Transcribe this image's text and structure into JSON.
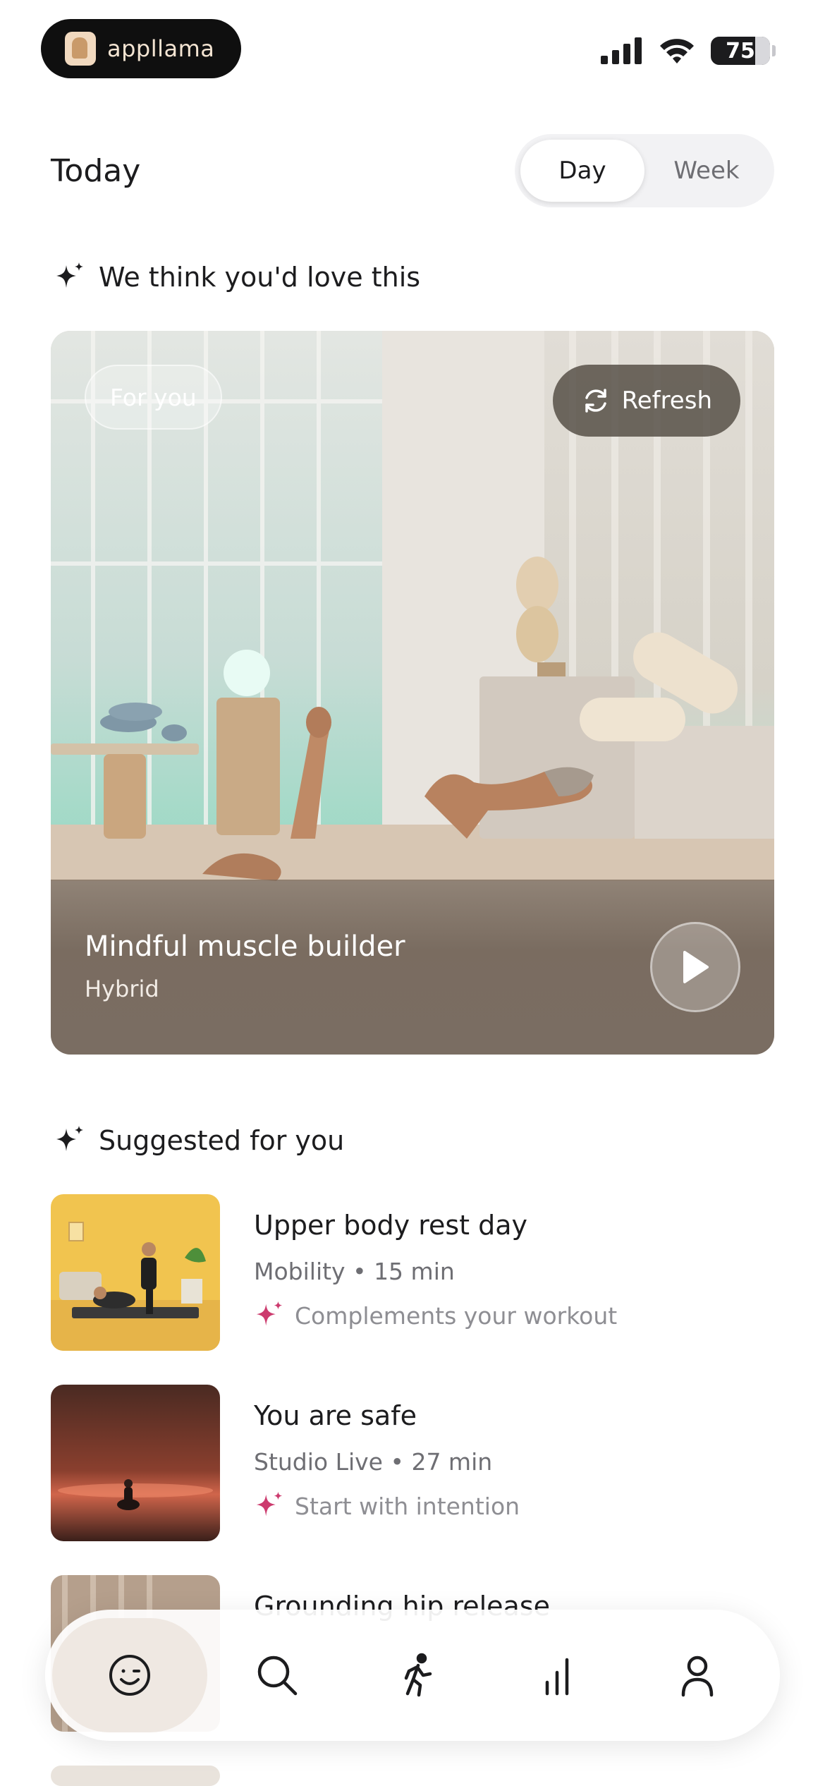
{
  "status_bar": {
    "app_name": "appllama",
    "battery": 75,
    "battery_label": "75"
  },
  "header": {
    "title": "Today",
    "segments": [
      "Day",
      "Week"
    ],
    "selected_segment": "Day"
  },
  "featured": {
    "heading": "We think you'd love this",
    "badge": "For you",
    "refresh_label": "Refresh",
    "title": "Mindful muscle builder",
    "subtitle": "Hybrid"
  },
  "suggested": {
    "heading": "Suggested for you",
    "items": [
      {
        "title": "Upper body rest day",
        "category": "Mobility",
        "duration": "15 min",
        "reason": "Complements your workout"
      },
      {
        "title": "You are safe",
        "category": "Studio Live",
        "duration": "27 min",
        "reason": "Start with intention"
      },
      {
        "title": "Grounding hip release"
      }
    ]
  },
  "tabbar": {
    "items": [
      {
        "icon": "smiley-icon",
        "active": true
      },
      {
        "icon": "search-icon",
        "active": false
      },
      {
        "icon": "running-icon",
        "active": false
      },
      {
        "icon": "stats-bars-icon",
        "active": false
      },
      {
        "icon": "profile-icon",
        "active": false
      }
    ]
  },
  "colors": {
    "accent_sparkle": "#cc3b6e",
    "text_primary": "#1c1c1e",
    "text_secondary": "#6e6e73"
  }
}
